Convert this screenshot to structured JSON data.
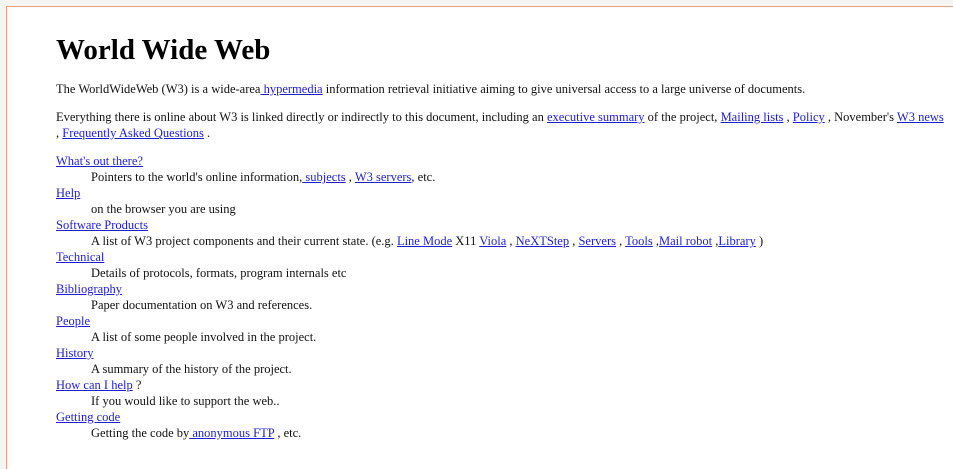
{
  "page": {
    "title": "World Wide Web",
    "intro": {
      "text_before": "The WorldWideWeb (W3) is a wide-area",
      "link_hypermedia": " hypermedia",
      "text_after": " information retrieval initiative aiming to give universal access to a large universe of documents."
    },
    "summary": {
      "text1": "Everything there is online about W3 is linked directly or indirectly to this document, including an ",
      "link_exec": "executive summary",
      "text2": " of the project, ",
      "link_mailing": "Mailing lists",
      "text3": " , ",
      "link_policy": "Policy",
      "text4": " , November's ",
      "link_news": "W3 news",
      "text5": " , ",
      "link_faq": "Frequently Asked Questions",
      "text6": " ."
    }
  },
  "entries": {
    "whats_out_there": {
      "term": "What's out there?",
      "desc_text1": "Pointers to the world's online information,",
      "link_subjects": " subjects",
      "desc_text2": " , ",
      "link_servers": "W3 servers",
      "desc_text3": ", etc."
    },
    "help": {
      "term": "Help",
      "desc": "on the browser you are using"
    },
    "software": {
      "term": "Software Products",
      "desc_text1": "A list of W3 project components and their current state. (e.g. ",
      "link_linemode": "Line Mode",
      "desc_x11": " X11 ",
      "link_viola": "Viola",
      "sep1": " , ",
      "link_nextstep": "NeXTStep",
      "sep2": " , ",
      "link_servers": "Servers",
      "sep3": " , ",
      "link_tools": "Tools",
      "sep4": " ,",
      "link_mailrobot": "Mail robot",
      "sep5": " ,",
      "link_library": "Library",
      "close": " )"
    },
    "technical": {
      "term": "Technical",
      "desc": "Details of protocols, formats, program internals etc"
    },
    "bibliography": {
      "term": "Bibliography",
      "desc": "Paper documentation on W3 and references."
    },
    "people": {
      "term": "People",
      "desc": "A list of some people involved in the project."
    },
    "history": {
      "term": "History",
      "desc": "A summary of the history of the project."
    },
    "how_can_i_help": {
      "term": "How can I help",
      "term_suffix": " ?",
      "desc": "If you would like to support the web.."
    },
    "getting_code": {
      "term": "Getting code",
      "desc_text1": "Getting the code by",
      "link_ftp": " anonymous FTP",
      "desc_text2": " , etc."
    }
  },
  "colors": {
    "link": "#1f1fd0",
    "frame_border": "#e9a27d",
    "background": "#ffffff"
  }
}
